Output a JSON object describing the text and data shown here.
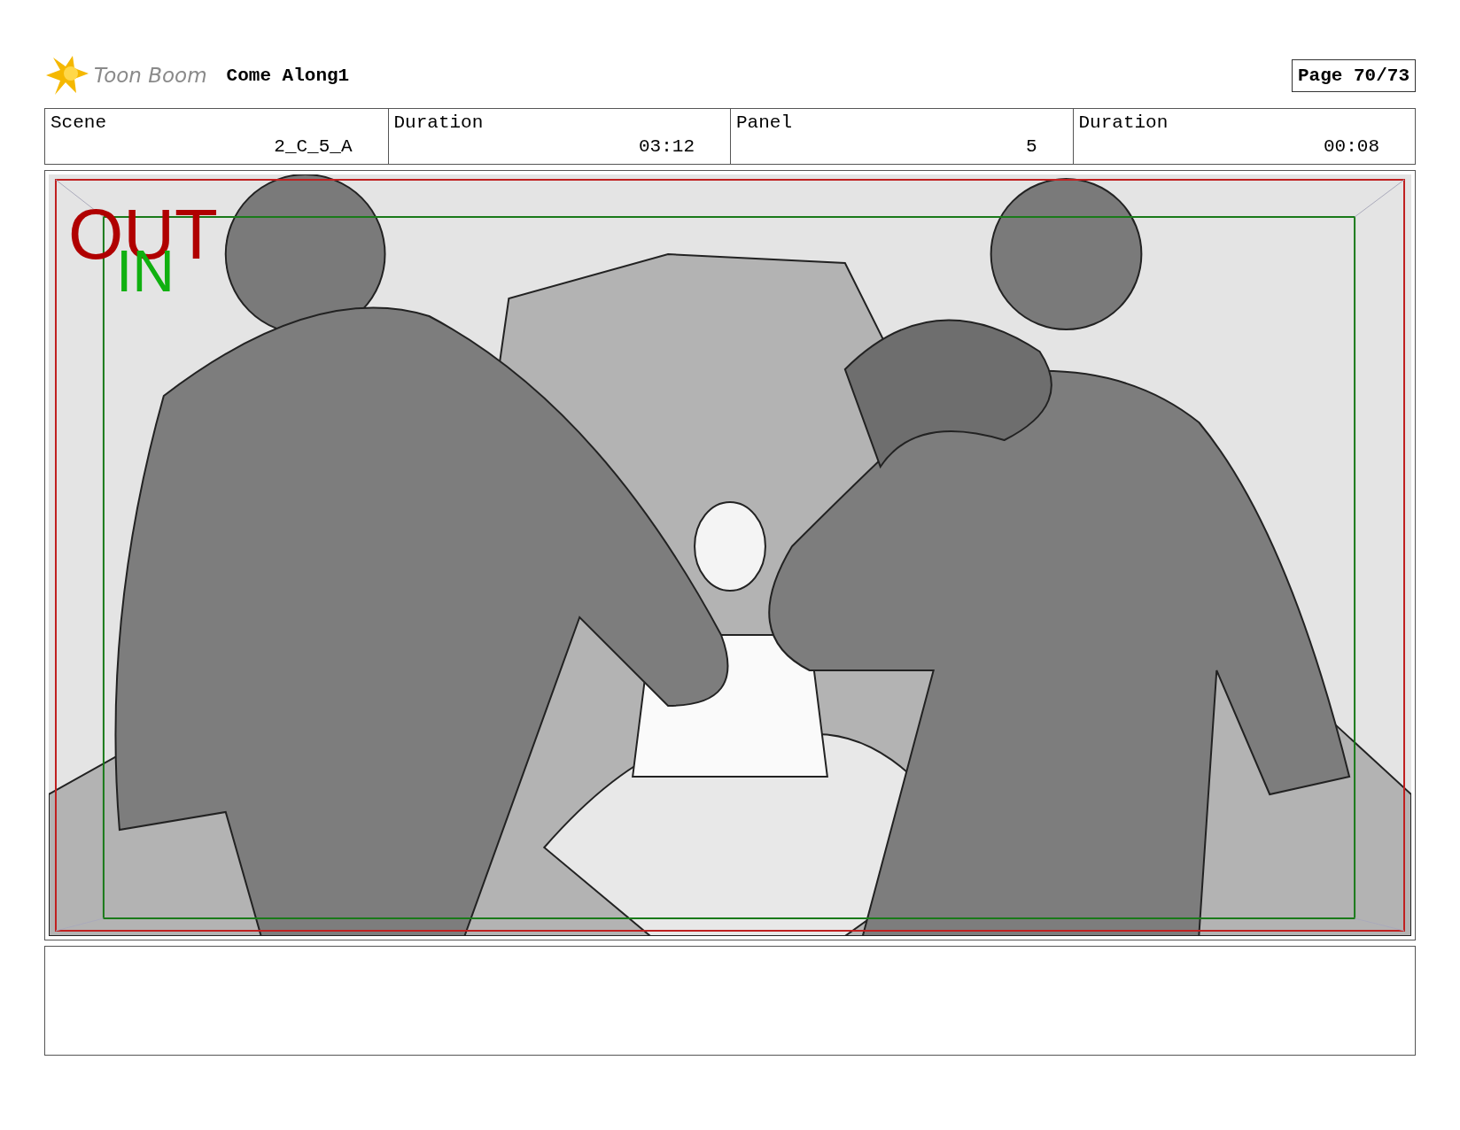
{
  "header": {
    "brand": "Toon Boom",
    "title": "Come Along1",
    "page": "Page 70/73"
  },
  "info": [
    {
      "label": "Scene",
      "value": "2_C_5_A"
    },
    {
      "label": "Duration",
      "value": "03:12"
    },
    {
      "label": "Panel",
      "value": "5"
    },
    {
      "label": "Duration",
      "value": "00:08"
    }
  ],
  "panel": {
    "overlay": {
      "outer": "OUT",
      "inner": "IN"
    }
  }
}
